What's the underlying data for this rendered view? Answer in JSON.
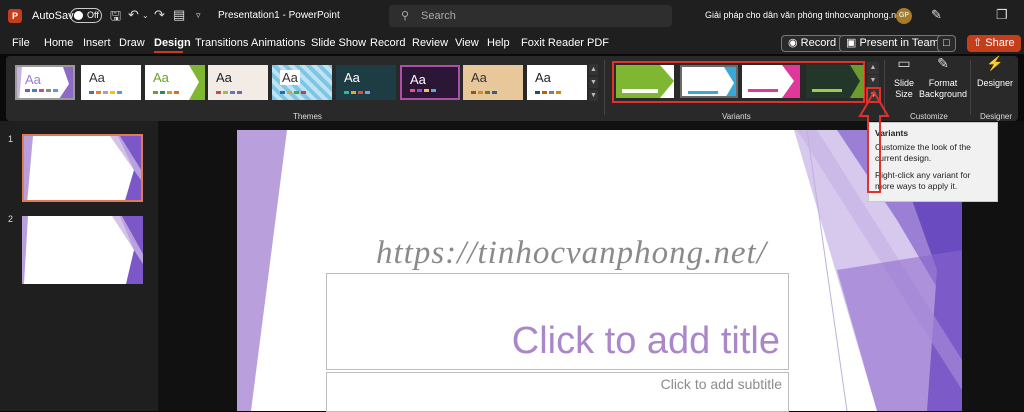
{
  "titlebar": {
    "app_logo": "P",
    "autosave_label": "AutoSave",
    "autosave_state": "Off",
    "document_title": "Presentation1 - PowerPoint",
    "search_placeholder": "Search",
    "account_name": "Giải pháp cho dân văn phòng tinhocvanphong.net",
    "avatar_initials": "GP"
  },
  "menu": {
    "tabs": [
      "File",
      "Home",
      "Insert",
      "Draw",
      "Design",
      "Transitions",
      "Animations",
      "Slide Show",
      "Record",
      "Review",
      "View",
      "Help",
      "Foxit Reader PDF"
    ],
    "active_tab": "Design",
    "record_label": "Record",
    "present_label": "Present in Teams",
    "share_label": "Share"
  },
  "ribbon": {
    "themes_label": "Themes",
    "variants_label": "Variants",
    "customize_label": "Customize",
    "designer_group_label": "Designer",
    "theme_text": "Aa",
    "slide_size_label": "Slide Size",
    "format_background_label": "Format Background",
    "designer_label": "Designer"
  },
  "tooltip": {
    "title": "Variants",
    "line1": "Customize the look of the current design.",
    "line2": "Right-click any variant for more ways to apply it."
  },
  "slides_panel": {
    "slide_numbers": [
      "1",
      "2"
    ]
  },
  "slide": {
    "watermark": "https://tinhocvanphong.net/",
    "title_placeholder": "Click to add title",
    "subtitle_placeholder": "Click to add subtitle"
  },
  "colors": {
    "accent": "#c43e1c",
    "highlight_red": "#e0312a",
    "purple": "#7b57c8"
  }
}
